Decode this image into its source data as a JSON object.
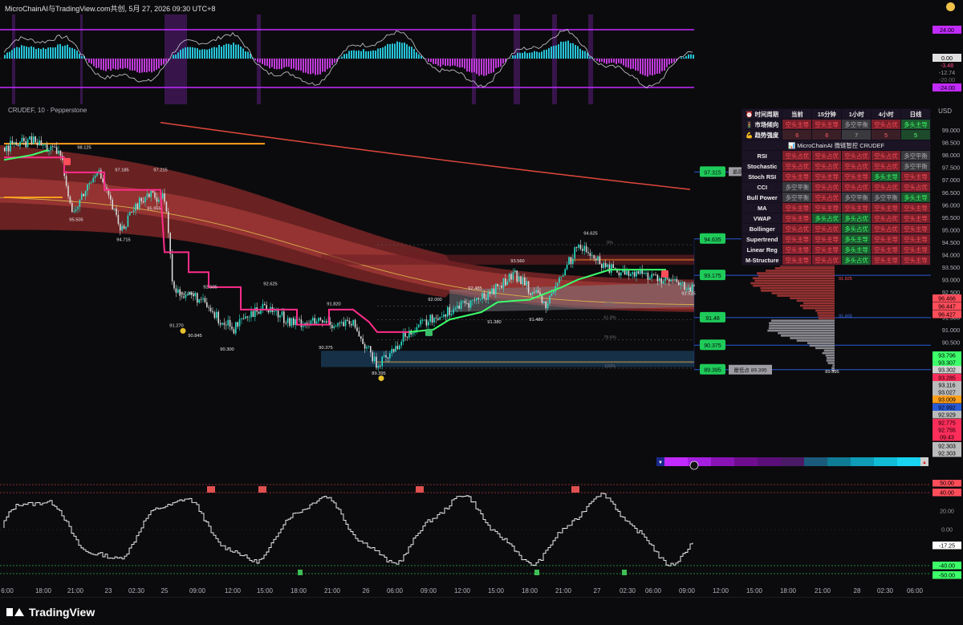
{
  "window": {
    "title": "MicroChainAI与TradingView.com共创, 5月 27, 2026 09:30 UTC+8"
  },
  "colors": {
    "background": "#0b0b0d",
    "bull": "#3cff6a",
    "bear": "#ff2d5a",
    "accent_orange": "#ff9f1a",
    "accent_magenta": "#c22bff",
    "level_blue": "#2a5bd7"
  },
  "top_oscillator": {
    "labels": {
      "upper": "24.00",
      "zero": "0.00",
      "v1": "-3.48",
      "v2": "-12.74",
      "v3": "-20.00",
      "lower": "-24.00"
    },
    "label_colors": {
      "upper": "#c22bff",
      "zero": "#cfcfcf",
      "v1": "#ff4d8a",
      "v2": "#9a9a9a",
      "v3": "#6b6b6b",
      "lower": "#c22bff"
    }
  },
  "main_chart": {
    "title": "CRUDEF, 10 · Pepperstone",
    "currency": "USD",
    "price_axis": [
      "99.000",
      "98.500",
      "98.000",
      "97.500",
      "97.000",
      "96.500",
      "96.000",
      "95.500",
      "95.000",
      "94.500",
      "94.000",
      "93.500",
      "93.000",
      "92.500",
      "92.000",
      "91.500",
      "91.000",
      "90.500",
      "90.000",
      "89.500",
      "89.000",
      "88.500"
    ],
    "price_tags": [
      {
        "text": "96.466",
        "color": "#ff4d5a"
      },
      {
        "text": "96.447",
        "color": "#ff4d5a"
      },
      {
        "text": "96.427",
        "color": "#ff4d5a"
      },
      {
        "text": "93.796",
        "color": "#3cff6a"
      },
      {
        "text": "93.307",
        "color": "#3cff6a"
      },
      {
        "text": "93.302",
        "color": "#d0d0d0"
      },
      {
        "text": "93.285",
        "color": "#ff2d5a"
      },
      {
        "text": "93.116",
        "color": "#bbbbbb"
      },
      {
        "text": "93.027",
        "color": "#bbbbbb"
      },
      {
        "text": "93.009",
        "color": "#ff9f1a"
      },
      {
        "text": "92.992",
        "color": "#2a5bd7"
      },
      {
        "text": "92.929",
        "color": "#bbbbbb"
      },
      {
        "text": "92.775",
        "color": "#ff2d5a"
      },
      {
        "text": "92.755",
        "color": "#ff2d5a"
      },
      {
        "text": "09:43",
        "color": "#ff2d5a"
      },
      {
        "text": "92.303",
        "color": "#bbbbbb"
      },
      {
        "text": "92.303",
        "color": "#bbbbbb"
      }
    ],
    "level_badges": [
      {
        "text": "97.315"
      },
      {
        "text": "94.635"
      },
      {
        "text": "93.175"
      },
      {
        "text": "91.48"
      },
      {
        "text": "90.375"
      },
      {
        "text": "89.395"
      }
    ],
    "low_label": "最低点 89.395",
    "high_label_short": "最高",
    "price_annotations": [
      "98.125",
      "97.185",
      "97.215",
      "95.505",
      "95.955",
      "94.715",
      "92.255",
      "92.505",
      "92.625",
      "91.820",
      "92.000",
      "91.270",
      "90.845",
      "90.300",
      "90.375",
      "89.395",
      "92.485",
      "93.560",
      "91.380",
      "91.480",
      "94.625",
      "92.525",
      "89.395"
    ],
    "fib_labels": [
      "0%",
      "50%",
      "61.8%",
      "78.6%",
      "100%"
    ],
    "profile_labels": [
      "94.377",
      "91.925",
      "91.468"
    ]
  },
  "mtf_table": {
    "header": [
      "⏰ 时间周期",
      "当前",
      "15分钟",
      "1小时",
      "4小时",
      "日线"
    ],
    "rows_top": [
      {
        "label": "🚦 市场倾向",
        "cells": [
          [
            "空头主导",
            "bear"
          ],
          [
            "空头主导",
            "bear"
          ],
          [
            "多空平衡",
            "neu"
          ],
          [
            "空头占优",
            "bear"
          ],
          [
            "多头主导",
            "bull"
          ]
        ]
      },
      {
        "label": "💪 趋势强度",
        "cells": [
          [
            "6",
            "num-red"
          ],
          [
            "6",
            "num-red"
          ],
          [
            "7",
            "neu"
          ],
          [
            "5",
            "num-red"
          ],
          [
            "5",
            "num-green"
          ]
        ]
      }
    ],
    "title": "📊 MicroChainAI 微链智控 CRUDEF",
    "rows": [
      {
        "label": "RSI",
        "cells": [
          [
            "空头占优",
            "bear"
          ],
          [
            "空头占优",
            "bear"
          ],
          [
            "空头占优",
            "bear"
          ],
          [
            "空头占优",
            "bear"
          ],
          [
            "多空平衡",
            "neu"
          ]
        ]
      },
      {
        "label": "Stochastic",
        "cells": [
          [
            "空头占优",
            "bear"
          ],
          [
            "空头占优",
            "bear"
          ],
          [
            "空头占优",
            "bear"
          ],
          [
            "空头占优",
            "bear"
          ],
          [
            "多空平衡",
            "neu"
          ]
        ]
      },
      {
        "label": "Stoch RSI",
        "cells": [
          [
            "空头主导",
            "bear"
          ],
          [
            "空头主导",
            "bear"
          ],
          [
            "空头主导",
            "bear"
          ],
          [
            "多头主导",
            "bull"
          ],
          [
            "空头主导",
            "bear"
          ]
        ]
      },
      {
        "label": "CCI",
        "cells": [
          [
            "多空平衡",
            "neu"
          ],
          [
            "空头占优",
            "bear"
          ],
          [
            "空头占优",
            "bear"
          ],
          [
            "空头占优",
            "bear"
          ],
          [
            "空头占优",
            "bear"
          ]
        ]
      },
      {
        "label": "Bull Power",
        "cells": [
          [
            "多空平衡",
            "neu"
          ],
          [
            "空头占优",
            "bear"
          ],
          [
            "多空平衡",
            "neu"
          ],
          [
            "多空平衡",
            "neu"
          ],
          [
            "多头主导",
            "bull"
          ]
        ]
      },
      {
        "label": "MA",
        "cells": [
          [
            "空头主导",
            "bear"
          ],
          [
            "空头主导",
            "bear"
          ],
          [
            "空头主导",
            "bear"
          ],
          [
            "空头主导",
            "bear"
          ],
          [
            "空头主导",
            "bear"
          ]
        ]
      },
      {
        "label": "VWAP",
        "cells": [
          [
            "空头主导",
            "bear"
          ],
          [
            "多头占优",
            "bull"
          ],
          [
            "多头占优",
            "bull"
          ],
          [
            "空头占优",
            "bear"
          ],
          [
            "空头主导",
            "bear"
          ]
        ]
      },
      {
        "label": "Bollinger",
        "cells": [
          [
            "空头占优",
            "bear"
          ],
          [
            "空头占优",
            "bear"
          ],
          [
            "多头占优",
            "bull"
          ],
          [
            "空头占优",
            "bear"
          ],
          [
            "空头主导",
            "bear"
          ]
        ]
      },
      {
        "label": "Supertrend",
        "cells": [
          [
            "空头主导",
            "bear"
          ],
          [
            "空头主导",
            "bear"
          ],
          [
            "多头主导",
            "bull"
          ],
          [
            "空头主导",
            "bear"
          ],
          [
            "空头主导",
            "bear"
          ]
        ]
      },
      {
        "label": "Linear Reg",
        "cells": [
          [
            "空头主导",
            "bear"
          ],
          [
            "空头主导",
            "bear"
          ],
          [
            "多头主导",
            "bull"
          ],
          [
            "空头主导",
            "bear"
          ],
          [
            "空头主导",
            "bear"
          ]
        ]
      },
      {
        "label": "M-Structure",
        "cells": [
          [
            "空头主导",
            "bear"
          ],
          [
            "空头占优",
            "bear"
          ],
          [
            "多头占优",
            "bull"
          ],
          [
            "空头主导",
            "bear"
          ],
          [
            "空头主导",
            "bear"
          ]
        ]
      }
    ]
  },
  "bottom_oscillator": {
    "labels": [
      {
        "text": "50.00",
        "color": "#ff4d5a"
      },
      {
        "text": "40.00",
        "color": "#ff4d5a"
      },
      {
        "text": "20.00",
        "color": "#9a9a9a"
      },
      {
        "text": "0.00",
        "color": "#9a9a9a"
      },
      {
        "text": "-17.25",
        "color": "#ffffff"
      },
      {
        "text": "-40.00",
        "color": "#3cff6a"
      },
      {
        "text": "-50.00",
        "color": "#3cff6a"
      }
    ]
  },
  "time_axis": [
    "6:00",
    "18:00",
    "21:00",
    "23",
    "02:30",
    "25",
    "09:00",
    "12:00",
    "15:00",
    "18:00",
    "21:00",
    "26",
    "06:00",
    "09:00",
    "12:00",
    "15:00",
    "18:00",
    "21:00",
    "27",
    "02:30",
    "06:00",
    "09:00",
    "12:00",
    "15:00",
    "18:00",
    "21:00",
    "28",
    "02:30",
    "06:00"
  ],
  "footer": {
    "brand": "TradingView"
  }
}
